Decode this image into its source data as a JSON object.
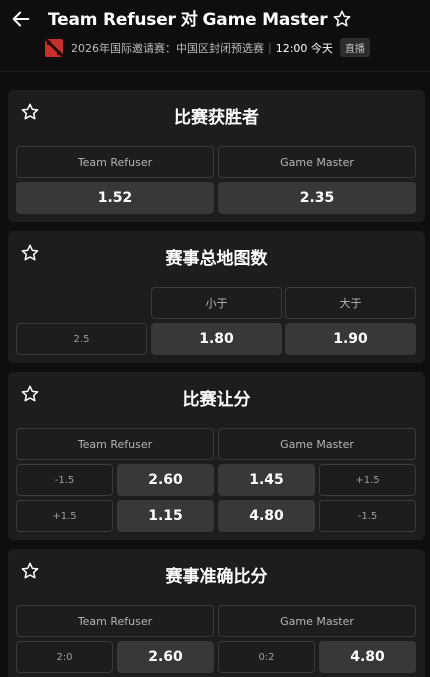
{
  "header": {
    "team1": "Team Refuser",
    "vs": "对",
    "team2": "Game Master",
    "event": "2026年国际邀请赛：中国区封闭预选赛",
    "separator": "|",
    "time": "12:00 今天",
    "live_badge": "直播"
  },
  "markets": {
    "winner": {
      "title": "比赛获胜者",
      "header_left": "Team Refuser",
      "header_right": "Game Master",
      "odd_left": "1.52",
      "odd_right": "2.35"
    },
    "total_maps": {
      "title": "赛事总地图数",
      "header_under": "小于",
      "header_over": "大于",
      "line": "2.5",
      "odd_under": "1.80",
      "odd_over": "1.90"
    },
    "handicap": {
      "title": "比赛让分",
      "header_left": "Team Refuser",
      "header_right": "Game Master",
      "rows": [
        {
          "left_line": "-1.5",
          "left_odd": "2.60",
          "right_odd": "1.45",
          "right_line": "+1.5"
        },
        {
          "left_line": "+1.5",
          "left_odd": "1.15",
          "right_odd": "4.80",
          "right_line": "-1.5"
        }
      ]
    },
    "correct_score": {
      "title": "赛事准确比分",
      "header_left": "Team Refuser",
      "header_right": "Game Master",
      "left_score": "2:0",
      "left_odd": "2.60",
      "right_score": "0:2",
      "right_odd": "4.80"
    }
  },
  "icons": [
    "back-arrow-icon",
    "star-icon",
    "dota-logo-icon"
  ]
}
